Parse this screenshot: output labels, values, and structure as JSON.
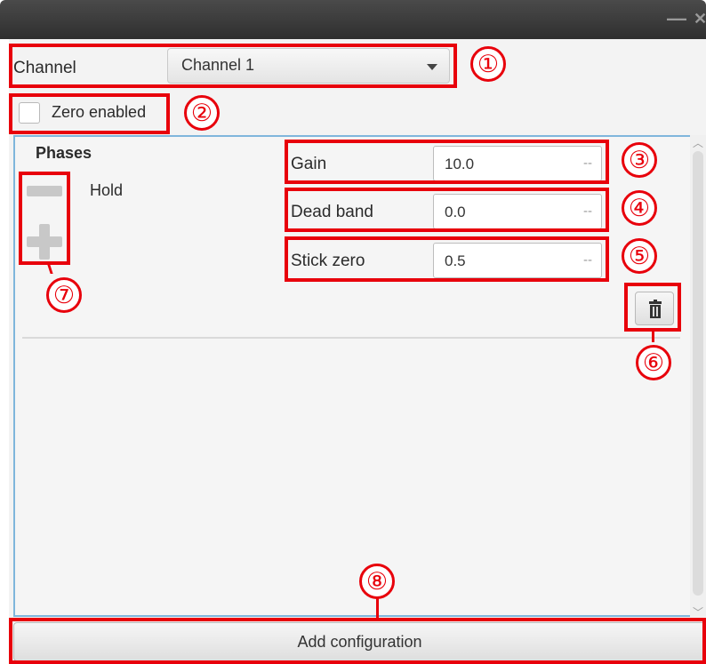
{
  "window": {
    "minimize_glyph": "—",
    "close_glyph": "✕"
  },
  "channel": {
    "label": "Channel",
    "selected": "Channel 1"
  },
  "zero_enabled": {
    "label": "Zero enabled",
    "checked": false
  },
  "phases": {
    "title": "Phases",
    "items": [
      "Hold"
    ]
  },
  "fields": {
    "gain": {
      "label": "Gain",
      "value": "10.0",
      "unit": "--"
    },
    "dead_band": {
      "label": "Dead band",
      "value": "0.0",
      "unit": "--"
    },
    "stick_zero": {
      "label": "Stick zero",
      "value": "0.5",
      "unit": "--"
    }
  },
  "buttons": {
    "add_configuration": "Add configuration"
  },
  "icons": {
    "remove_phase": "minus-icon",
    "add_phase": "plus-icon",
    "delete": "trash-icon",
    "dropdown": "chevron-down-icon"
  },
  "callouts": [
    "①",
    "②",
    "③",
    "④",
    "⑤",
    "⑥",
    "⑦",
    "⑧"
  ],
  "colors": {
    "annotation": "#e8000b",
    "panel_border": "#7fb6dc",
    "titlebar": "#3a3a3a"
  }
}
